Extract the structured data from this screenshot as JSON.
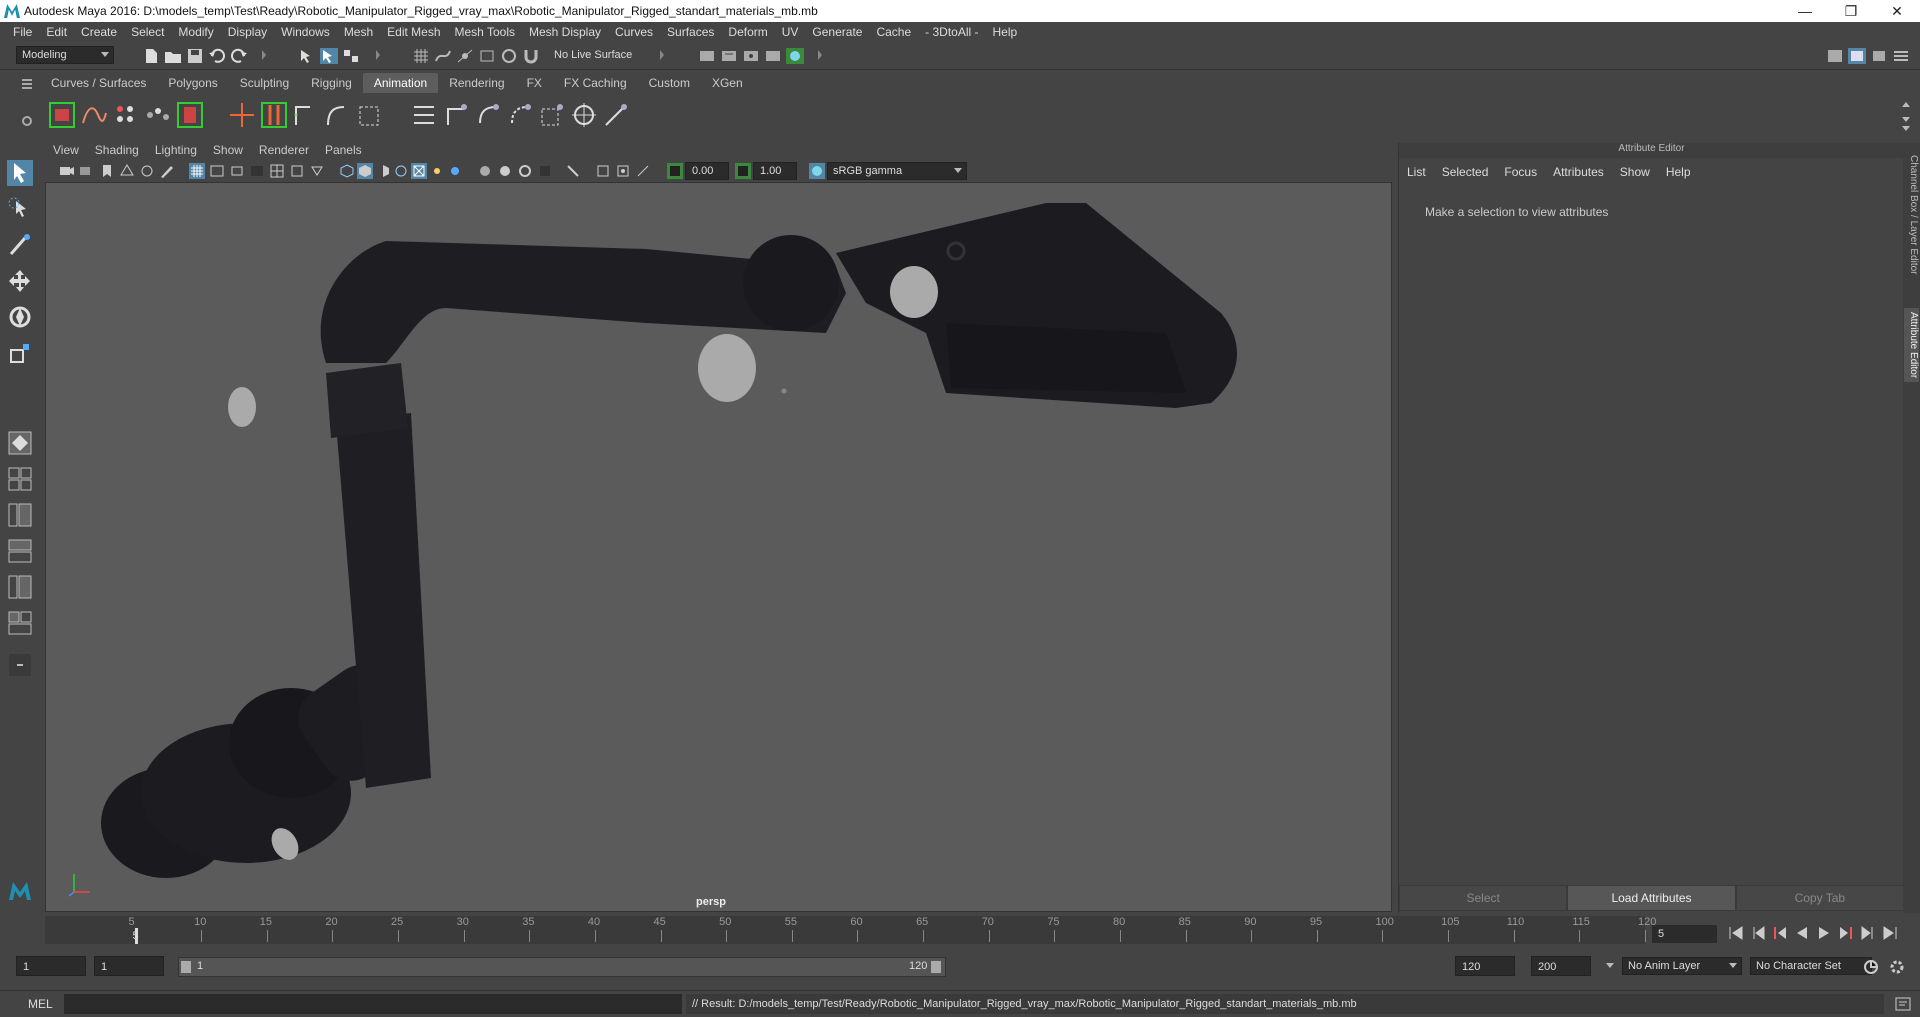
{
  "window": {
    "title": "Autodesk Maya 2016: D:\\models_temp\\Test\\Ready\\Robotic_Manipulator_Rigged_vray_max\\Robotic_Manipulator_Rigged_standart_materials_mb.mb",
    "minimize": "—",
    "restore": "❐",
    "close": "✕"
  },
  "menubar": [
    "File",
    "Edit",
    "Create",
    "Select",
    "Modify",
    "Display",
    "Windows",
    "Mesh",
    "Edit Mesh",
    "Mesh Tools",
    "Mesh Display",
    "Curves",
    "Surfaces",
    "Deform",
    "UV",
    "Generate",
    "Cache",
    "- 3DtoAll -",
    "Help"
  ],
  "statusline": {
    "mode": "Modeling",
    "live_surface": "No Live Surface"
  },
  "shelf": {
    "tabs": [
      "Curves / Surfaces",
      "Polygons",
      "Sculpting",
      "Rigging",
      "Animation",
      "Rendering",
      "FX",
      "FX Caching",
      "Custom",
      "XGen"
    ],
    "active_tab": "Animation"
  },
  "viewport": {
    "menu": [
      "View",
      "Shading",
      "Lighting",
      "Show",
      "Renderer",
      "Panels"
    ],
    "exposure": "0.00",
    "gamma": "1.00",
    "color_space": "sRGB gamma",
    "camera_label": "persp"
  },
  "attribute_editor": {
    "title": "Attribute Editor",
    "menu": [
      "List",
      "Selected",
      "Focus",
      "Attributes",
      "Show",
      "Help"
    ],
    "message": "Make a selection to view attributes",
    "buttons": [
      "Select",
      "Load Attributes",
      "Copy Tab"
    ],
    "side_tabs": [
      "Channel Box / Layer Editor",
      "Attribute Editor"
    ]
  },
  "timeslider": {
    "labels": [
      "5",
      "10",
      "15",
      "20",
      "25",
      "30",
      "35",
      "40",
      "45",
      "50",
      "55",
      "60",
      "65",
      "70",
      "75",
      "80",
      "85",
      "90",
      "95",
      "100",
      "105",
      "110",
      "115",
      "120"
    ],
    "start_label": "5",
    "current_frame": "5"
  },
  "range": {
    "start": "1",
    "playback_start": "1",
    "slider_start": "1",
    "slider_end": "120",
    "playback_end": "120",
    "end": "200",
    "anim_layer": "No Anim Layer",
    "character_set": "No Character Set"
  },
  "commandline": {
    "lang": "MEL",
    "result": "// Result: D:/models_temp/Test/Ready/Robotic_Manipulator_Rigged_vray_max/Robotic_Manipulator_Rigged_standart_materials_mb.mb"
  }
}
